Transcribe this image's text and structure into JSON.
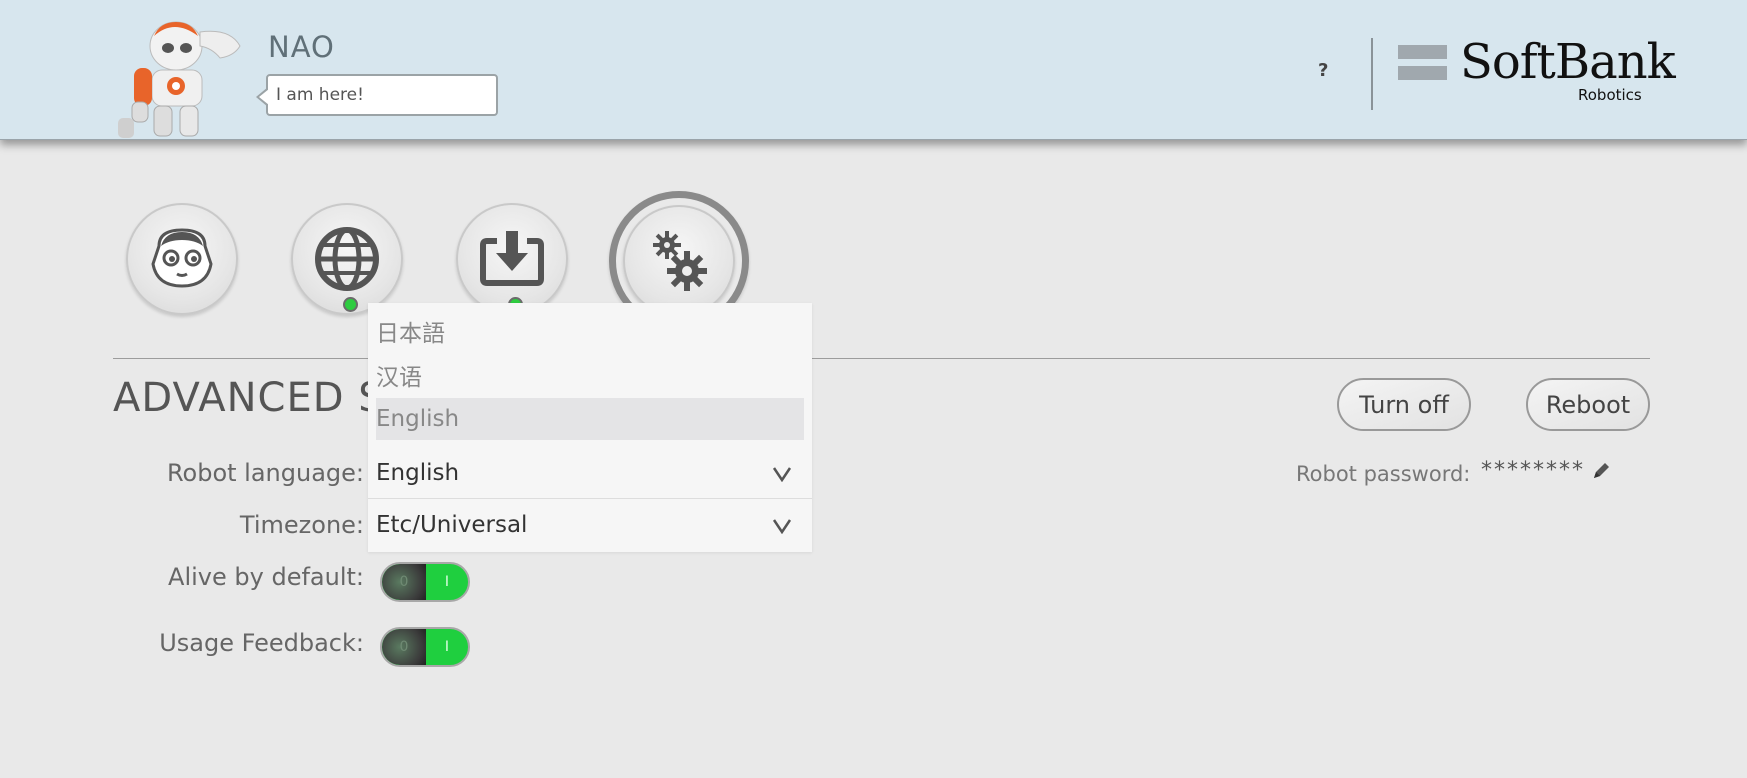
{
  "header": {
    "robot_name": "NAO",
    "speech_text": "I am here!",
    "help_label": "?",
    "brand_name": "SoftBank",
    "brand_sub": "Robotics"
  },
  "nav": {
    "items": [
      {
        "name": "robot-face",
        "status": "none",
        "active": false
      },
      {
        "name": "globe",
        "status": "connected",
        "active": false
      },
      {
        "name": "download",
        "status": "connected",
        "active": false
      },
      {
        "name": "settings-gears",
        "status": "none",
        "active": true
      }
    ]
  },
  "section": {
    "title": "ADVANCED SE",
    "turn_off_label": "Turn off",
    "reboot_label": "Reboot"
  },
  "settings": {
    "robot_language_label": "Robot language:",
    "robot_language_value": "English",
    "timezone_label": "Timezone:",
    "timezone_value": "Etc/Universal",
    "alive_label": "Alive by default:",
    "alive_on": true,
    "feedback_label": "Usage Feedback:",
    "feedback_on": true,
    "toggle_off_text": "0",
    "toggle_on_text": "I",
    "password_label": "Robot password:",
    "password_value": "********"
  },
  "language_dropdown": {
    "options": [
      "日本語",
      "汉语",
      "English"
    ],
    "selected": "English"
  },
  "colors": {
    "header_bg": "#d7e6ee",
    "page_bg": "#e9e9e9",
    "status_green": "#2ecc40",
    "toggle_green": "#1fcf3f"
  }
}
